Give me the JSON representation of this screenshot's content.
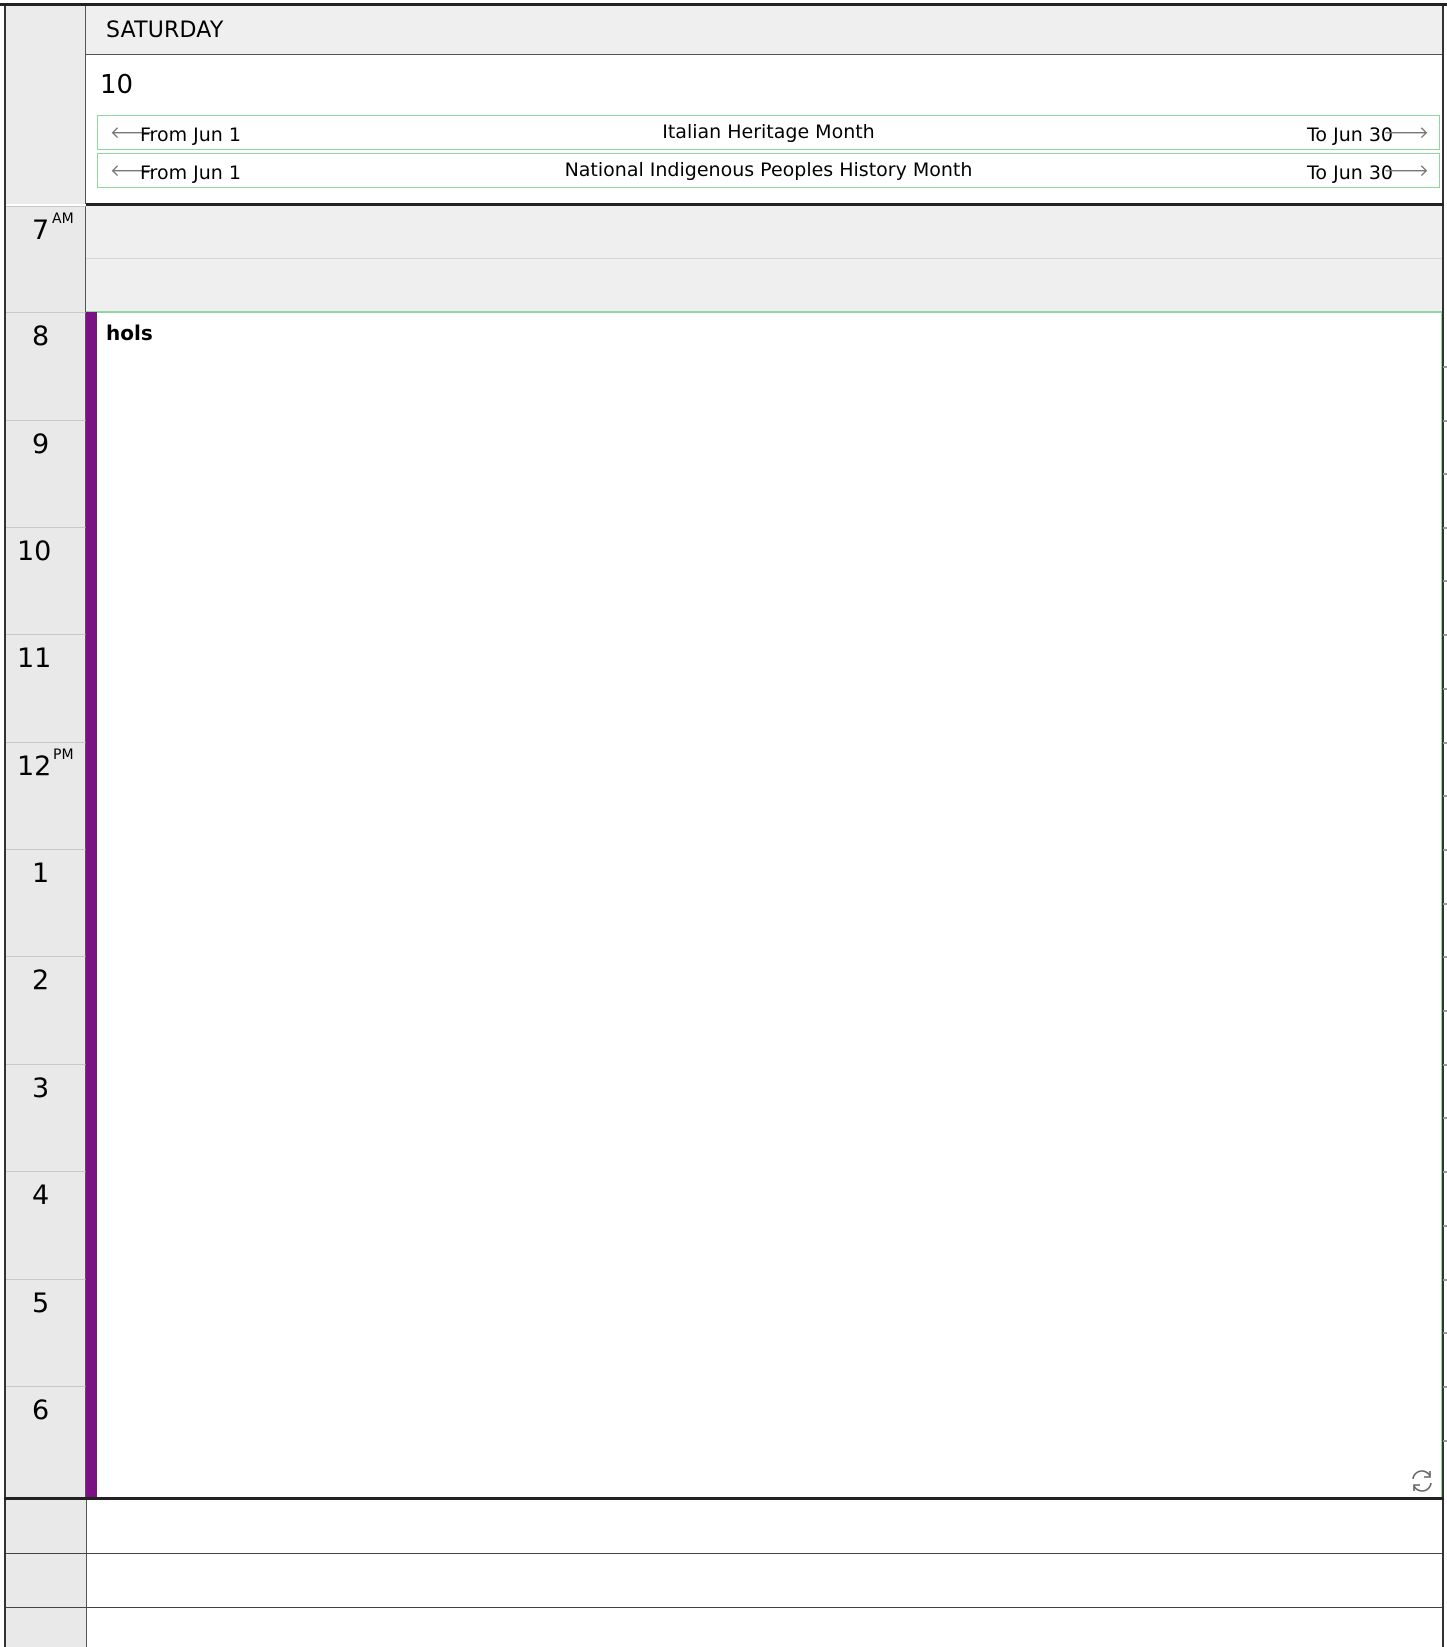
{
  "day": {
    "name": "SATURDAY",
    "number": "10"
  },
  "all_day_events": [
    {
      "from": "From Jun 1",
      "title": "Italian Heritage Month",
      "to": "To Jun 30"
    },
    {
      "from": "From Jun 1",
      "title": "National Indigenous Peoples History Month",
      "to": "To Jun 30"
    }
  ],
  "hours": [
    {
      "num": "7",
      "ampm": "AM"
    },
    {
      "num": "8",
      "ampm": ""
    },
    {
      "num": "9",
      "ampm": ""
    },
    {
      "num": "10",
      "ampm": ""
    },
    {
      "num": "11",
      "ampm": ""
    },
    {
      "num": "12",
      "ampm": "PM"
    },
    {
      "num": "1",
      "ampm": ""
    },
    {
      "num": "2",
      "ampm": ""
    },
    {
      "num": "3",
      "ampm": ""
    },
    {
      "num": "4",
      "ampm": ""
    },
    {
      "num": "5",
      "ampm": ""
    },
    {
      "num": "6",
      "ampm": ""
    }
  ],
  "event": {
    "title": "hols",
    "color": "#7b0f85",
    "recurring_icon": "sync-icon"
  },
  "colors": {
    "all_day_border": "#8fd7a1",
    "gutter": "#e9e9e9"
  }
}
